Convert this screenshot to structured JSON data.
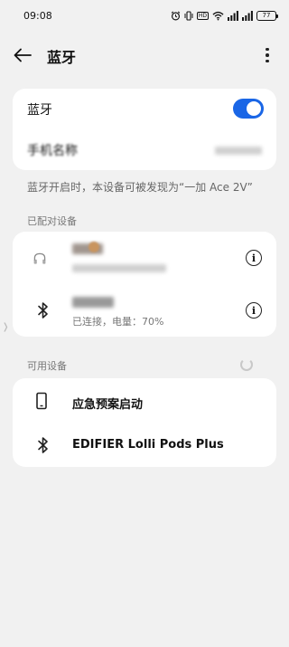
{
  "status_bar": {
    "time": "09:08",
    "hd_label": "HD",
    "battery": "77"
  },
  "header": {
    "title": "蓝牙"
  },
  "bluetooth_card": {
    "toggle_label": "蓝牙",
    "toggle_on": true,
    "device_name_label": "手机名称",
    "device_name_value": ""
  },
  "helper_text": "蓝牙开启时，本设备可被发现为“一加 Ace 2V”",
  "paired_section": {
    "label": "已配对设备",
    "devices": [
      {
        "name": "",
        "status": ""
      },
      {
        "name": "",
        "status": "已连接，电量：70%"
      }
    ]
  },
  "available_section": {
    "label": "可用设备",
    "devices": [
      {
        "icon": "phone-icon",
        "name": "应急预案启动"
      },
      {
        "icon": "bluetooth-icon",
        "name": "EDIFIER Lolli Pods Plus"
      }
    ]
  },
  "colors": {
    "accent": "#1a66e6",
    "background": "#f1f1f1",
    "card": "#ffffff"
  }
}
